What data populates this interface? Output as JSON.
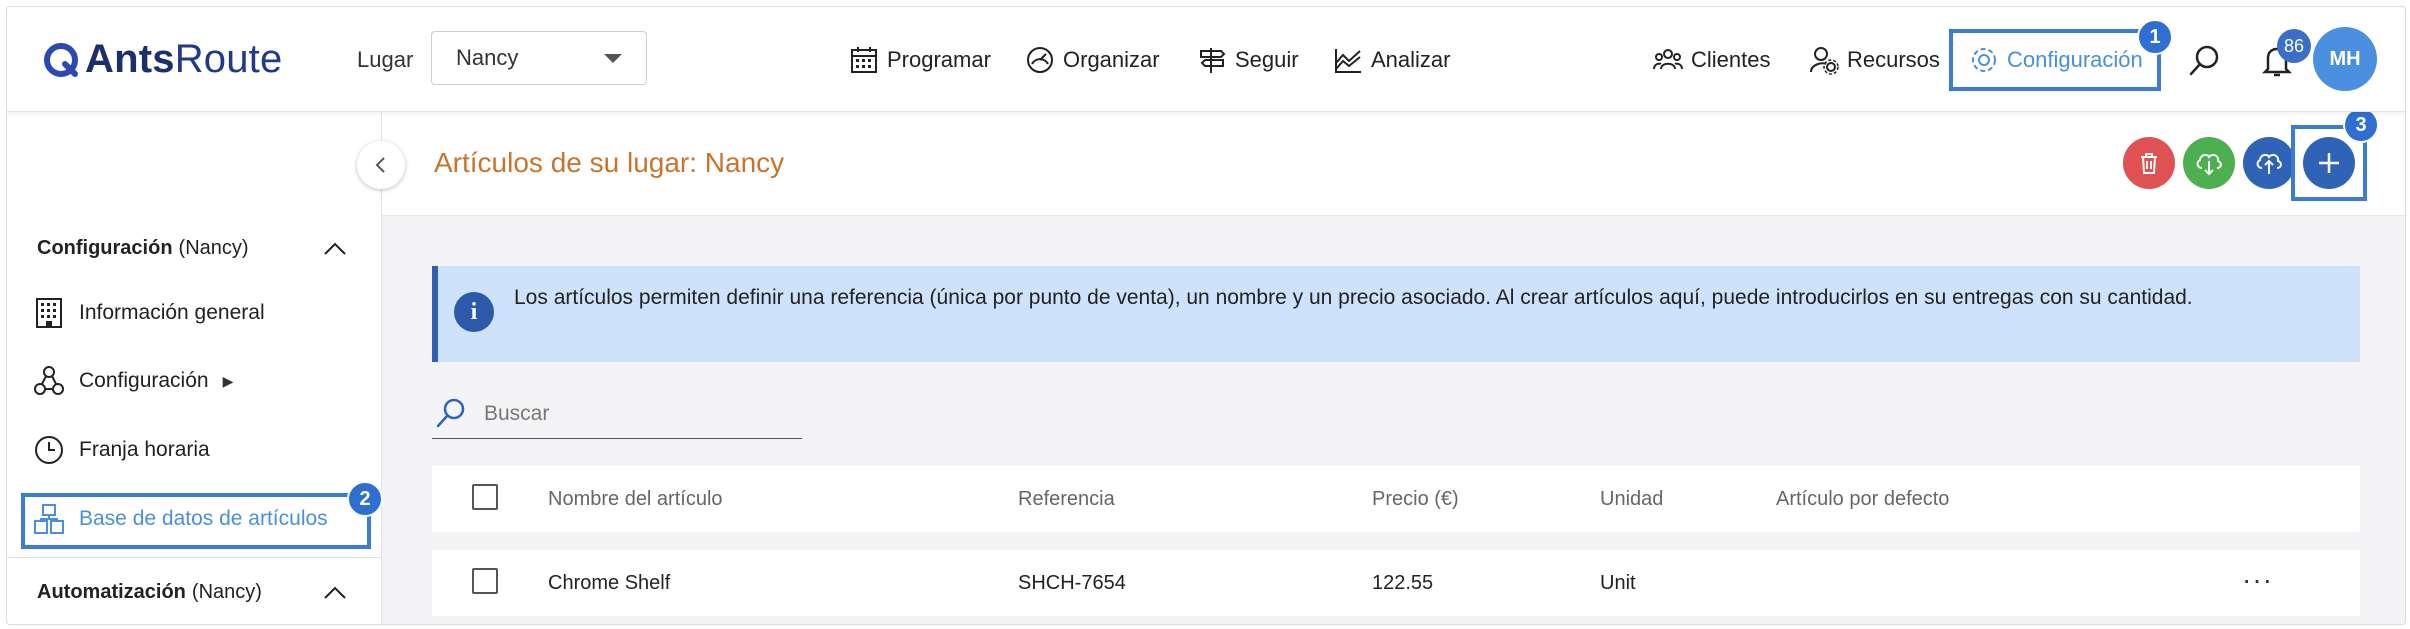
{
  "app": {
    "logo_text_bold": "Ants",
    "logo_text_light": "Route"
  },
  "header": {
    "lugar_label": "Lugar",
    "lugar_value": "Nancy",
    "nav": [
      {
        "label": "Programar",
        "icon": "calendar-icon"
      },
      {
        "label": "Organizar",
        "icon": "gauge-icon"
      },
      {
        "label": "Seguir",
        "icon": "signpost-icon"
      },
      {
        "label": "Analizar",
        "icon": "chart-icon"
      }
    ],
    "right_nav": [
      {
        "label": "Clientes",
        "icon": "users-icon"
      },
      {
        "label": "Recursos",
        "icon": "user-gear-icon"
      },
      {
        "label": "Configuración",
        "icon": "gear-icon"
      }
    ],
    "notification_count": "86",
    "avatar_initials": "MH"
  },
  "callouts": [
    "1",
    "2",
    "3"
  ],
  "sidebar": {
    "section1": {
      "title": "Configuración",
      "context": "(Nancy)"
    },
    "items": [
      {
        "label": "Información general",
        "icon": "building-icon"
      },
      {
        "label": "Configuración",
        "icon": "nodes-icon",
        "suffix": "▶"
      },
      {
        "label": "Franja horaria",
        "icon": "clock-icon"
      },
      {
        "label": "Base de datos de artículos",
        "icon": "boxes-icon"
      }
    ],
    "section2": {
      "title": "Automatización",
      "context": "(Nancy)"
    }
  },
  "main": {
    "title": "Artículos de su lugar: Nancy",
    "info_text": "Los artículos permiten definir una referencia (única por punto de venta), un nombre y un precio asociado. Al crear artículos aquí, puede introducirlos en su entregas con su cantidad.",
    "search_placeholder": "Buscar",
    "table": {
      "headers": [
        "Nombre del artículo",
        "Referencia",
        "Precio (€)",
        "Unidad",
        "Artículo por defecto"
      ],
      "rows": [
        {
          "name": "Chrome Shelf",
          "reference": "SHCH-7654",
          "price": "122.55",
          "unit": "Unit",
          "default": ""
        }
      ]
    }
  },
  "colors": {
    "accent": "#4a90d9",
    "title_orange": "#c8742e",
    "delete_red": "#e05252",
    "download_green": "#4caf50",
    "upload_blue": "#2f63b5",
    "highlight": "#3a7bd5",
    "info_bg": "#cfe2fb"
  }
}
